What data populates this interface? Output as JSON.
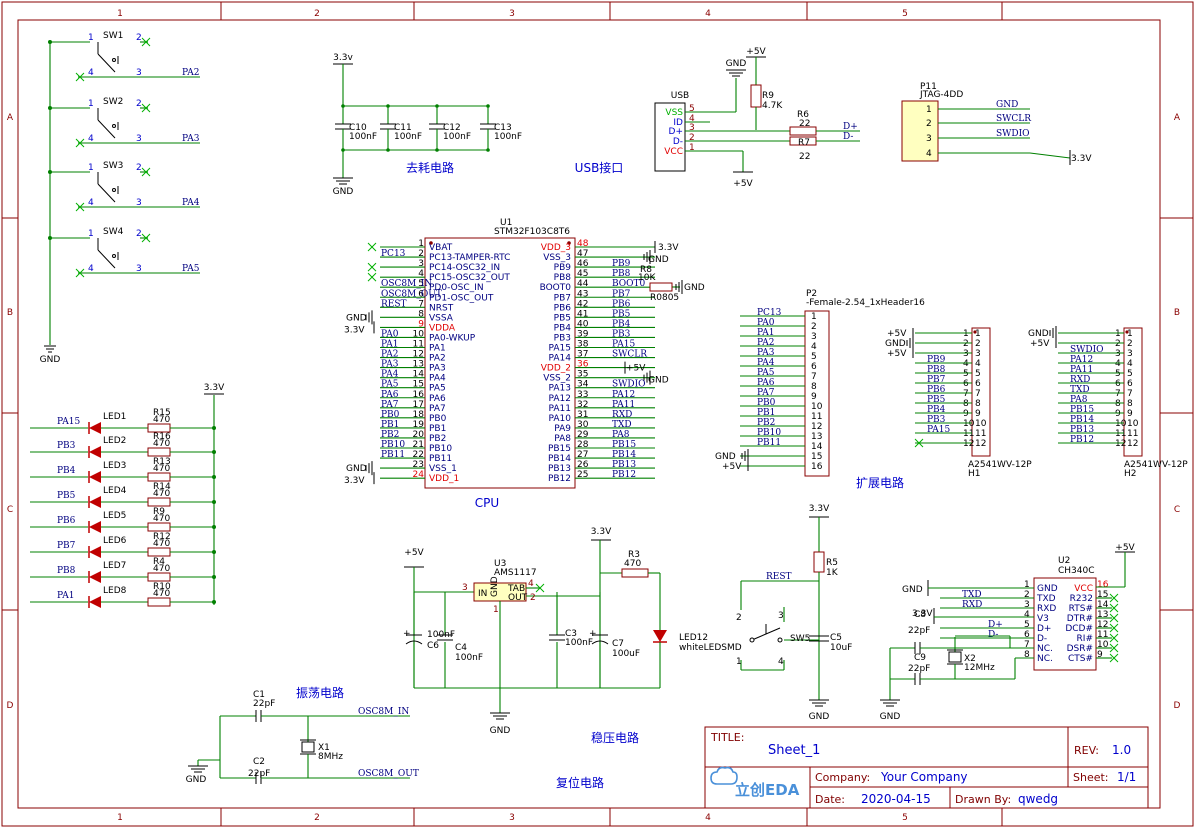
{
  "border": {
    "cols": [
      "1",
      "2",
      "3",
      "4",
      "5"
    ],
    "rows": [
      "A",
      "B",
      "C",
      "D"
    ]
  },
  "sections": {
    "decoupling": "去耗电路",
    "usb": "USB接口",
    "cpu": "CPU",
    "expansion": "扩展电路",
    "oscillator": "振荡电路",
    "regulator": "稳压电路",
    "reset": "复位电路"
  },
  "rails": {
    "v33": "3.3V",
    "v33_lower": "3.3v",
    "v5": "+5V",
    "gnd": "GND"
  },
  "switches": [
    {
      "ref": "SW1",
      "net": "PA2"
    },
    {
      "ref": "SW2",
      "net": "PA3"
    },
    {
      "ref": "SW3",
      "net": "PA4"
    },
    {
      "ref": "SW4",
      "net": "PA5"
    }
  ],
  "switch_pins": {
    "p1": "1",
    "p2": "2",
    "p3": "3",
    "p4": "4"
  },
  "leds": [
    {
      "net": "PA15",
      "ref": "LED1",
      "res": "R15",
      "val": "470"
    },
    {
      "net": "PB3",
      "ref": "LED2",
      "res": "R16",
      "val": "470"
    },
    {
      "net": "PB4",
      "ref": "LED3",
      "res": "R13",
      "val": "470"
    },
    {
      "net": "PB5",
      "ref": "LED4",
      "res": "R14",
      "val": "470"
    },
    {
      "net": "PB6",
      "ref": "LED5",
      "res": "R9",
      "val": "470"
    },
    {
      "net": "PB7",
      "ref": "LED6",
      "res": "R12",
      "val": "470"
    },
    {
      "net": "PB8",
      "ref": "LED7",
      "res": "R4",
      "val": "470"
    },
    {
      "net": "PA1",
      "ref": "LED8",
      "res": "R10",
      "val": "470"
    }
  ],
  "caps_decoupling": [
    {
      "ref": "C10",
      "val": "100nF"
    },
    {
      "ref": "C11",
      "val": "100nF"
    },
    {
      "ref": "C12",
      "val": "100nF"
    },
    {
      "ref": "C13",
      "val": "100nF"
    }
  ],
  "usb": {
    "ref": "USB",
    "pins": [
      {
        "name": "VSS",
        "num": "5"
      },
      {
        "name": "ID",
        "num": "4"
      },
      {
        "name": "D+",
        "num": "3"
      },
      {
        "name": "D-",
        "num": "2"
      },
      {
        "name": "VCC",
        "num": "1"
      }
    ],
    "r9": "R9",
    "r9_val": "4.7K",
    "r6": "R6",
    "r6_val": "22",
    "r7": "R7",
    "r7_val": "22",
    "dp": "D+",
    "dm": "D-"
  },
  "jtag": {
    "ref": "P11",
    "part": "JTAG-4DD",
    "pins": [
      {
        "num": "1",
        "net": "GND"
      },
      {
        "num": "2",
        "net": "SWCLR"
      },
      {
        "num": "3",
        "net": "SWDIO"
      },
      {
        "num": "4",
        "net": "3.3V"
      }
    ]
  },
  "mcu": {
    "ref": "U1",
    "part": "STM32F103C8T6",
    "left": [
      {
        "num": "1",
        "name": "VBAT",
        "net": ""
      },
      {
        "num": "2",
        "name": "PC13-TAMPER-RTC",
        "net": "PC13"
      },
      {
        "num": "3",
        "name": "PC14-OSC32_IN",
        "net": ""
      },
      {
        "num": "4",
        "name": "PC15-OSC32_OUT",
        "net": ""
      },
      {
        "num": "5",
        "name": "PD0-OSC_IN",
        "net": "OSC8M_IN"
      },
      {
        "num": "6",
        "name": "PD1-OSC_OUT",
        "net": "OSC8M_OUT"
      },
      {
        "num": "7",
        "name": "NRST",
        "net": "REST"
      },
      {
        "num": "8",
        "name": "VSSA",
        "net": "GND"
      },
      {
        "num": "9",
        "name": "VDDA",
        "net": "3.3V"
      },
      {
        "num": "10",
        "name": "PA0-WKUP",
        "net": "PA0"
      },
      {
        "num": "11",
        "name": "PA1",
        "net": "PA1"
      },
      {
        "num": "12",
        "name": "PA2",
        "net": "PA2"
      },
      {
        "num": "13",
        "name": "PA3",
        "net": "PA3"
      },
      {
        "num": "14",
        "name": "PA4",
        "net": "PA4"
      },
      {
        "num": "15",
        "name": "PA5",
        "net": "PA5"
      },
      {
        "num": "16",
        "name": "PA6",
        "net": "PA6"
      },
      {
        "num": "17",
        "name": "PA7",
        "net": "PA7"
      },
      {
        "num": "18",
        "name": "PB0",
        "net": "PB0"
      },
      {
        "num": "19",
        "name": "PB1",
        "net": "PB1"
      },
      {
        "num": "20",
        "name": "PB2",
        "net": "PB2"
      },
      {
        "num": "21",
        "name": "PB10",
        "net": "PB10"
      },
      {
        "num": "22",
        "name": "PB11",
        "net": "PB11"
      },
      {
        "num": "23",
        "name": "VSS_1",
        "net": "GND"
      },
      {
        "num": "24",
        "name": "VDD_1",
        "net": "3.3V"
      }
    ],
    "right": [
      {
        "num": "48",
        "name": "VDD_3",
        "net": "3.3V"
      },
      {
        "num": "47",
        "name": "VSS_3",
        "net": "GND"
      },
      {
        "num": "46",
        "name": "PB9",
        "net": "PB9"
      },
      {
        "num": "45",
        "name": "PB8",
        "net": "PB8"
      },
      {
        "num": "44",
        "name": "BOOT0",
        "net": "BOOT0"
      },
      {
        "num": "43",
        "name": "PB7",
        "net": "PB7"
      },
      {
        "num": "42",
        "name": "PB6",
        "net": "PB6"
      },
      {
        "num": "41",
        "name": "PB5",
        "net": "PB5"
      },
      {
        "num": "40",
        "name": "PB4",
        "net": "PB4"
      },
      {
        "num": "39",
        "name": "PB3",
        "net": "PB3"
      },
      {
        "num": "38",
        "name": "PA15",
        "net": "PA15"
      },
      {
        "num": "37",
        "name": "PA14",
        "net": "SWCLR"
      },
      {
        "num": "36",
        "name": "VDD_2",
        "net": "+5V"
      },
      {
        "num": "35",
        "name": "VSS_2",
        "net": "GND"
      },
      {
        "num": "34",
        "name": "PA13",
        "net": "SWDIO"
      },
      {
        "num": "33",
        "name": "PA12",
        "net": "PA12"
      },
      {
        "num": "32",
        "name": "PA11",
        "net": "PA11"
      },
      {
        "num": "31",
        "name": "PA10",
        "net": "RXD"
      },
      {
        "num": "30",
        "name": "PA9",
        "net": "TXD"
      },
      {
        "num": "29",
        "name": "PA8",
        "net": "PA8"
      },
      {
        "num": "28",
        "name": "PB15",
        "net": "PB15"
      },
      {
        "num": "27",
        "name": "PB14",
        "net": "PB14"
      },
      {
        "num": "26",
        "name": "PB13",
        "net": "PB13"
      },
      {
        "num": "25",
        "name": "PB12",
        "net": "PB12"
      }
    ],
    "r8": "R8",
    "r8_val": "10K",
    "r8_pkg": "R0805"
  },
  "p2": {
    "ref": "P2",
    "part": "-Female-2.54_1xHeader16",
    "nets": [
      "PC13",
      "PA0",
      "PA1",
      "PA2",
      "PA3",
      "PA4",
      "PA5",
      "PA6",
      "PA7",
      "PB0",
      "PB1",
      "PB2",
      "PB10",
      "PB11",
      "GND",
      "+5V"
    ]
  },
  "h1": {
    "ref": "H1",
    "part": "A2541WV-12P",
    "nets": [
      "+5V",
      "GND",
      "+5V",
      "PB9",
      "PB8",
      "PB7",
      "PB6",
      "PB5",
      "PB4",
      "PB3",
      "PA15",
      ""
    ]
  },
  "h2": {
    "ref": "H2",
    "part": "A2541WV-12P",
    "nets": [
      "GND",
      "+5V",
      "SWDIO",
      "PA12",
      "PA11",
      "RXD",
      "TXD",
      "PA8",
      "PB15",
      "PB14",
      "PB13",
      "PB12"
    ]
  },
  "ldo": {
    "ref": "U3",
    "part": "AMS1117",
    "in": "IN",
    "gnd": "GND",
    "tab": "TAB",
    "out": "OUT",
    "c6": "C6",
    "c6_val": "100nF",
    "c4": "C4",
    "c4_val": "100nF",
    "c3": "C3",
    "c3_val": "100nF",
    "c7": "C7",
    "c7_val": "100uF",
    "r3": "R3",
    "r3_val": "470",
    "led12": "LED12",
    "led12_val": "whiteLEDSMD"
  },
  "reset": {
    "net": "REST",
    "r5": "R5",
    "r5_val": "1K",
    "sw5": "SW5",
    "c5": "C5",
    "c5_val": "10uF"
  },
  "osc": {
    "c1": "C1",
    "c1_val": "22pF",
    "c2": "C2",
    "c2_val": "22pF",
    "x1": "X1",
    "x1_val": "8MHz",
    "in": "OSC8M_IN",
    "out": "OSC8M_OUT"
  },
  "ch340": {
    "ref": "U2",
    "part": "CH340C",
    "left": [
      {
        "num": "1",
        "name": "GND",
        "net": "GND"
      },
      {
        "num": "2",
        "name": "TXD",
        "net": "TXD"
      },
      {
        "num": "3",
        "name": "RXD",
        "net": "RXD"
      },
      {
        "num": "4",
        "name": "V3",
        "net": ""
      },
      {
        "num": "5",
        "name": "D+",
        "net": "D+"
      },
      {
        "num": "6",
        "name": "D-",
        "net": "D-"
      },
      {
        "num": "7",
        "name": "NC.",
        "net": ""
      },
      {
        "num": "8",
        "name": "NC.",
        "net": ""
      }
    ],
    "right": [
      {
        "num": "16",
        "name": "VCC"
      },
      {
        "num": "15",
        "name": "R232"
      },
      {
        "num": "14",
        "name": "RTS#"
      },
      {
        "num": "13",
        "name": "DTR#"
      },
      {
        "num": "12",
        "name": "DCD#"
      },
      {
        "num": "11",
        "name": "RI#"
      },
      {
        "num": "10",
        "name": "DSR#"
      },
      {
        "num": "9",
        "name": "CTS#"
      }
    ],
    "c8": "C8",
    "c8_val": "22pF",
    "c9": "C9",
    "c9_val": "22pF",
    "x2": "X2",
    "x2_val": "12MHz"
  },
  "titleblock": {
    "title_label": "TITLE:",
    "title": "Sheet_1",
    "rev_label": "REV:",
    "rev": "1.0",
    "company_label": "Company:",
    "company": "Your Company",
    "sheet_label": "Sheet:",
    "sheet": "1/1",
    "date_label": "Date:",
    "date": "2020-04-15",
    "drawn_label": "Drawn By:",
    "drawn": "qwedg",
    "logo": "立创EDA"
  }
}
